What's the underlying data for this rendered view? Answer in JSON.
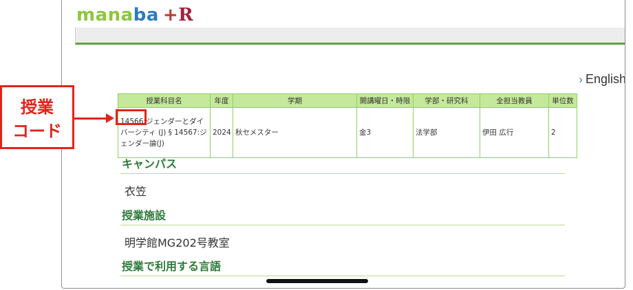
{
  "logo": {
    "part1": "mana",
    "part2": "ba",
    "plus": "+",
    "r": "R"
  },
  "language_link": "English",
  "course_table": {
    "headers": [
      "授業科目名",
      "年度",
      "学期",
      "開講曜日・時限",
      "学部・研究科",
      "全担当教員",
      "単位数"
    ],
    "row": {
      "course_name": "14566:ジェンダーとダイバーシティ (J) § 14567:ジェンダー論(J)",
      "year": "2024",
      "term": "秋セメスター",
      "period": "金3",
      "faculty": "法学部",
      "instructor": "伊田 広行",
      "credits": "2"
    }
  },
  "sections": [
    {
      "title": "キャンパス",
      "value": "衣笠"
    },
    {
      "title": "授業施設",
      "value": "明学館MG202号教室"
    },
    {
      "title": "授業で利用する言語",
      "value": ""
    }
  ],
  "callout": {
    "line1": "授業",
    "line2": "コード"
  },
  "colors": {
    "accent_green": "#5fa33b",
    "table_header": "#c4e99a",
    "annotation_red": "#e2231a"
  }
}
